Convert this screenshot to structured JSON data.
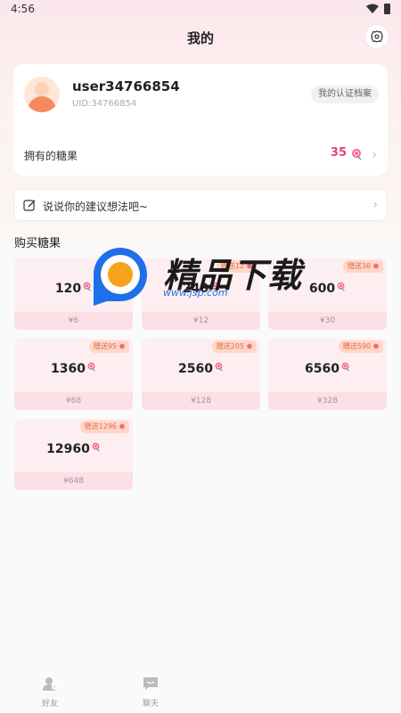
{
  "status": {
    "time": "4:56"
  },
  "header": {
    "title": "我的"
  },
  "profile": {
    "username": "user34766854",
    "uid": "UID:34766854",
    "cert_label": "我的认证档案",
    "candy_label": "拥有的糖果",
    "candy_count": "35"
  },
  "suggest": {
    "text": "说说你的建议想法吧~"
  },
  "shop": {
    "title": "购买糖果",
    "tiles": [
      {
        "amount": "120",
        "price": "¥6",
        "bonus": ""
      },
      {
        "amount": "240",
        "price": "¥12",
        "bonus": "赠送12"
      },
      {
        "amount": "600",
        "price": "¥30",
        "bonus": "赠送36"
      },
      {
        "amount": "1360",
        "price": "¥68",
        "bonus": "赠送95"
      },
      {
        "amount": "2560",
        "price": "¥128",
        "bonus": "赠送205"
      },
      {
        "amount": "6560",
        "price": "¥328",
        "bonus": "赠送590"
      },
      {
        "amount": "12960",
        "price": "¥648",
        "bonus": "赠送1296"
      }
    ]
  },
  "watermark": {
    "title": "精品下载",
    "url": "www.jsp.com"
  },
  "tabbar": {
    "friends": "好友",
    "chat": "聊天"
  },
  "colors": {
    "accent": "#e0457b",
    "bonus_text": "#e06b55",
    "tile_bg": "#fdeef1"
  }
}
